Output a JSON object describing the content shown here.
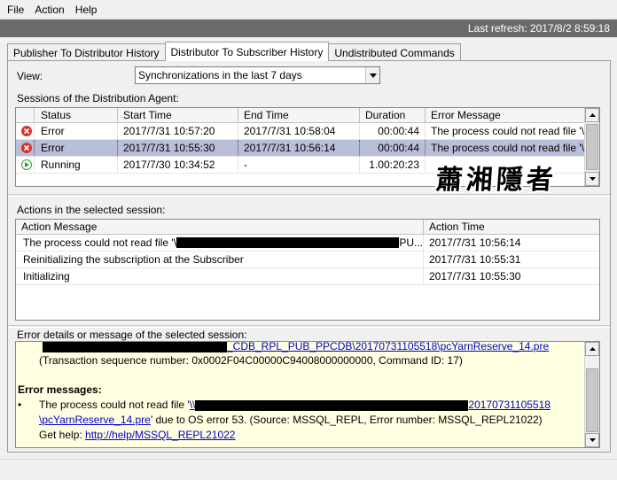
{
  "menu": [
    "File",
    "Action",
    "Help"
  ],
  "last_refresh": "Last refresh: 2017/8/2 8:59:18",
  "tabs": [
    "Publisher To Distributor History",
    "Distributor To Subscriber History",
    "Undistributed Commands"
  ],
  "view": {
    "label": "View:",
    "selected": "Synchronizations in the last 7 days"
  },
  "sessions": {
    "label": "Sessions of the Distribution Agent:",
    "columns": [
      "Status",
      "Start Time",
      "End Time",
      "Duration",
      "Error Message"
    ],
    "rows": [
      {
        "icon": "error-icon",
        "status": "Error",
        "start": "2017/7/31 10:57:20",
        "end": "2017/7/31 10:58:04",
        "duration": "00:00:44",
        "message": "The process could not read file '\\..."
      },
      {
        "icon": "error-icon",
        "status": "Error",
        "start": "2017/7/31 10:55:30",
        "end": "2017/7/31 10:56:14",
        "duration": "00:00:44",
        "message": "The process could not read file '\\..."
      },
      {
        "icon": "running-icon",
        "status": "Running",
        "start": "2017/7/30 10:34:52",
        "end": "-",
        "duration": "1.00:20:23",
        "message": ""
      }
    ]
  },
  "watermark": "蕭湘隱者",
  "actions": {
    "label": "Actions in the selected session:",
    "columns": [
      "Action Message",
      "Action Time"
    ],
    "rows": [
      {
        "message_prefix": "The process could not read file '\\",
        "message_suffix": "PU...",
        "time": "2017/7/31 10:56:14"
      },
      {
        "message_prefix": "Reinitializing the subscription at the Subscriber",
        "message_suffix": "",
        "time": "2017/7/31 10:55:31"
      },
      {
        "message_prefix": "Initializing",
        "message_suffix": "",
        "time": "2017/7/31 10:55:30"
      }
    ]
  },
  "error_details": {
    "label": "Error details or message of the selected session:",
    "path_top": "_CDB_RPL_PUB_PPCDB\\20170731105518\\pcYarnReserve_14.pre",
    "transaction": "(Transaction sequence number: 0x0002F04C00000C94008000000000, Command ID: 17)",
    "heading": "Error messages:",
    "message_start": "The process could not read file '",
    "path_start": "\\\\",
    "path_end": "20170731105518",
    "path_line2": "\\pcYarnReserve_14.pre",
    "message_rest": "' due to OS error 53. (Source: MSSQL_REPL, Error number: MSSQL_REPL21022)",
    "help_label": "Get help: ",
    "help_link": "http://help/MSSQL_REPL21022"
  }
}
